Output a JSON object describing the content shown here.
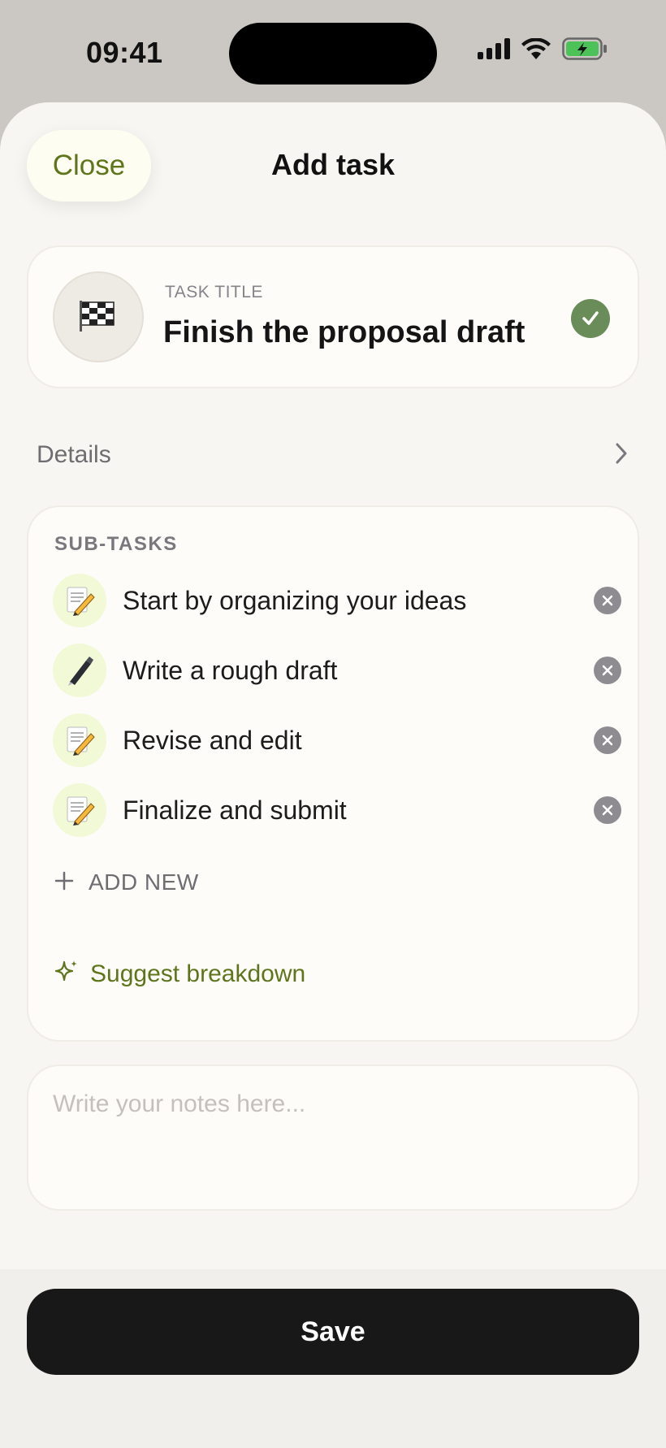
{
  "status_bar": {
    "time": "09:41"
  },
  "header": {
    "close_label": "Close",
    "title": "Add task"
  },
  "task": {
    "title_label": "TASK TITLE",
    "title_value": "Finish the proposal draft",
    "emoji": "🏁"
  },
  "details": {
    "label": "Details"
  },
  "subtasks": {
    "header": "SUB-TASKS",
    "items": [
      {
        "emoji": "📝",
        "label": "Start by organizing your ideas"
      },
      {
        "emoji": "🖋️",
        "label": "Write a rough draft"
      },
      {
        "emoji": "📝",
        "label": "Revise and edit"
      },
      {
        "emoji": "📝",
        "label": "Finalize and submit"
      }
    ],
    "add_new_label": "ADD NEW",
    "suggest_label": "Suggest breakdown"
  },
  "notes": {
    "placeholder": "Write your notes here..."
  },
  "footer": {
    "save_label": "Save"
  },
  "colors": {
    "accent_green": "#5f751c",
    "check_green": "#6a8c58",
    "save_button": "#181818"
  },
  "icons": [
    "signal-icon",
    "wifi-icon",
    "battery-icon",
    "checkmark-icon",
    "chevron-right-icon",
    "close-icon",
    "plus-icon",
    "sparkle-icon"
  ]
}
